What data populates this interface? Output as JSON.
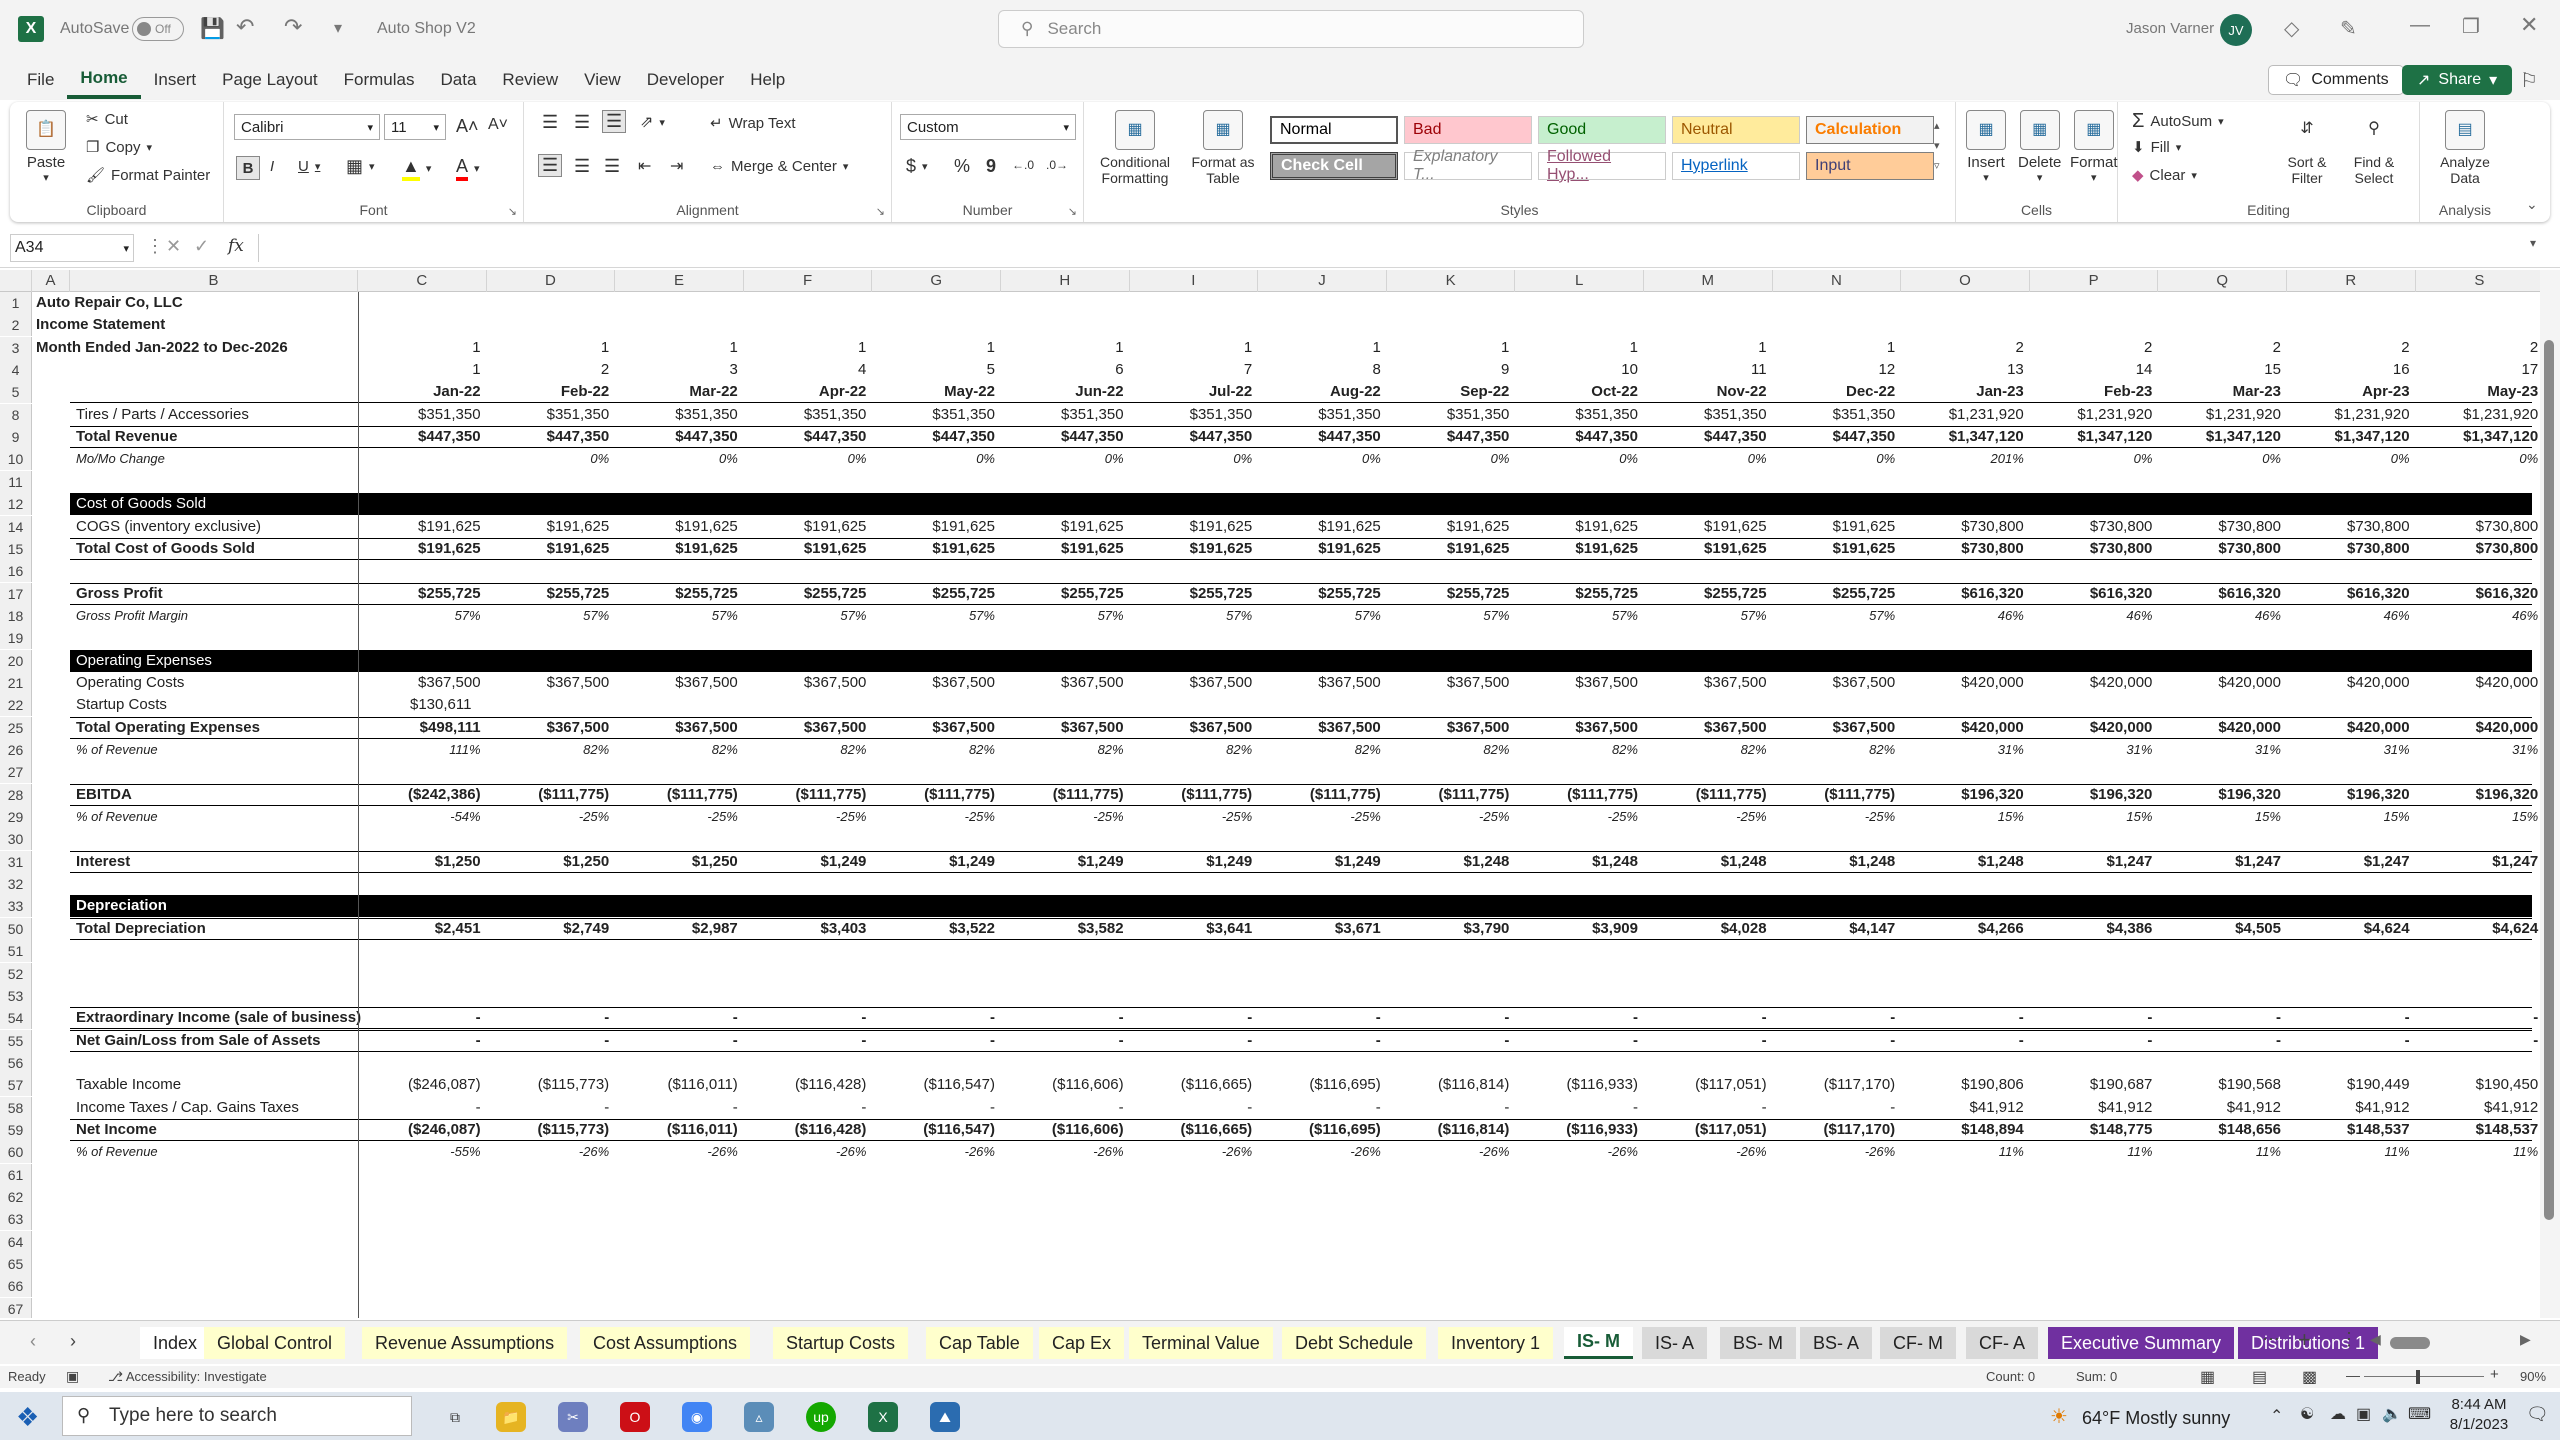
{
  "titlebar": {
    "autosave_label": "AutoSave",
    "autosave_state": "Off",
    "doc_title": "Auto Shop V2",
    "search_placeholder": "Search",
    "user_name": "Jason Varner",
    "user_initials": "JV"
  },
  "menu": {
    "items": [
      "File",
      "Home",
      "Insert",
      "Page Layout",
      "Formulas",
      "Data",
      "Review",
      "View",
      "Developer",
      "Help"
    ],
    "active": "Home",
    "comments_label": "Comments",
    "share_label": "Share"
  },
  "ribbon": {
    "clipboard": {
      "label": "Clipboard",
      "paste": "Paste",
      "cut": "Cut",
      "copy": "Copy",
      "format_painter": "Format Painter"
    },
    "font": {
      "label": "Font",
      "font_name": "Calibri",
      "font_size": "11",
      "bold": "B",
      "italic": "I",
      "underline": "U"
    },
    "alignment": {
      "label": "Alignment",
      "wrap_text": "Wrap Text",
      "merge_center": "Merge & Center"
    },
    "number": {
      "label": "Number",
      "format": "Custom",
      "currency": "$",
      "percent": "%",
      "comma": "9"
    },
    "styles": {
      "label": "Styles",
      "conditional_formatting": "Conditional Formatting",
      "format_as_table": "Format as Table",
      "cells": [
        {
          "name": "Normal",
          "bg": "#ffffff",
          "fg": "#000000"
        },
        {
          "name": "Bad",
          "bg": "#ffc7ce",
          "fg": "#9c0006"
        },
        {
          "name": "Good",
          "bg": "#c6efce",
          "fg": "#006100"
        },
        {
          "name": "Neutral",
          "bg": "#ffeb9c",
          "fg": "#9c5700"
        },
        {
          "name": "Calculation",
          "bg": "#f2f2f2",
          "fg": "#fa7d00"
        },
        {
          "name": "Check Cell",
          "bg": "#a5a5a5",
          "fg": "#ffffff"
        },
        {
          "name": "Explanatory T...",
          "bg": "#ffffff",
          "fg": "#7f7f7f"
        },
        {
          "name": "Followed Hyp...",
          "bg": "#ffffff",
          "fg": "#954f72"
        },
        {
          "name": "Hyperlink",
          "bg": "#ffffff",
          "fg": "#0563c1"
        },
        {
          "name": "Input",
          "bg": "#ffcc99",
          "fg": "#3f3f76"
        }
      ]
    },
    "cells": {
      "label": "Cells",
      "insert": "Insert",
      "delete": "Delete",
      "format": "Format"
    },
    "editing": {
      "label": "Editing",
      "autosum": "AutoSum",
      "fill": "Fill",
      "clear": "Clear",
      "sort_filter": "Sort & Filter",
      "find_select": "Find & Select"
    },
    "analysis": {
      "label": "Analysis",
      "analyze_data": "Analyze Data"
    }
  },
  "formula_bar": {
    "name_box": "A34",
    "fx": "fx",
    "formula": ""
  },
  "columns": [
    "A",
    "B",
    "C",
    "D",
    "E",
    "F",
    "G",
    "H",
    "I",
    "J",
    "K",
    "L",
    "M",
    "N",
    "O",
    "P",
    "Q",
    "R",
    "S"
  ],
  "sheet": {
    "rows": [
      {
        "n": "1",
        "label": "Auto Repair Co, LLC",
        "style": "title",
        "values": []
      },
      {
        "n": "2",
        "label": "Income Statement",
        "style": "title",
        "values": []
      },
      {
        "n": "3",
        "label": "Month Ended Jan-2022 to Dec-2026",
        "style": "title",
        "values": [
          "1",
          "1",
          "1",
          "1",
          "1",
          "1",
          "1",
          "1",
          "1",
          "1",
          "1",
          "1",
          "2",
          "2",
          "2",
          "2",
          "2"
        ]
      },
      {
        "n": "4",
        "label": "",
        "style": "plain",
        "values": [
          "1",
          "2",
          "3",
          "4",
          "5",
          "6",
          "7",
          "8",
          "9",
          "10",
          "11",
          "12",
          "13",
          "14",
          "15",
          "16",
          "17"
        ]
      },
      {
        "n": "5",
        "label": "",
        "style": "dates",
        "values": [
          "Jan-22",
          "Feb-22",
          "Mar-22",
          "Apr-22",
          "May-22",
          "Jun-22",
          "Jul-22",
          "Aug-22",
          "Sep-22",
          "Oct-22",
          "Nov-22",
          "Dec-22",
          "Jan-23",
          "Feb-23",
          "Mar-23",
          "Apr-23",
          "May-23"
        ]
      },
      {
        "n": "8",
        "label": "Tires / Parts / Accessories",
        "style": "plain",
        "values": [
          "$351,350",
          "$351,350",
          "$351,350",
          "$351,350",
          "$351,350",
          "$351,350",
          "$351,350",
          "$351,350",
          "$351,350",
          "$351,350",
          "$351,350",
          "$351,350",
          "$1,231,920",
          "$1,231,920",
          "$1,231,920",
          "$1,231,920",
          "$1,231,920"
        ]
      },
      {
        "n": "9",
        "label": "Total Revenue",
        "style": "total",
        "values": [
          "$447,350",
          "$447,350",
          "$447,350",
          "$447,350",
          "$447,350",
          "$447,350",
          "$447,350",
          "$447,350",
          "$447,350",
          "$447,350",
          "$447,350",
          "$447,350",
          "$1,347,120",
          "$1,347,120",
          "$1,347,120",
          "$1,347,120",
          "$1,347,120"
        ]
      },
      {
        "n": "10",
        "label": "Mo/Mo Change",
        "style": "ital",
        "values": [
          "",
          "0%",
          "0%",
          "0%",
          "0%",
          "0%",
          "0%",
          "0%",
          "0%",
          "0%",
          "0%",
          "0%",
          "201%",
          "0%",
          "0%",
          "0%",
          "0%"
        ]
      },
      {
        "n": "11",
        "label": "",
        "style": "plain",
        "values": []
      },
      {
        "n": "12",
        "label": "Cost of Goods Sold",
        "style": "hdr",
        "values": []
      },
      {
        "n": "14",
        "label": "COGS (inventory exclusive)",
        "style": "plain",
        "values": [
          "$191,625",
          "$191,625",
          "$191,625",
          "$191,625",
          "$191,625",
          "$191,625",
          "$191,625",
          "$191,625",
          "$191,625",
          "$191,625",
          "$191,625",
          "$191,625",
          "$730,800",
          "$730,800",
          "$730,800",
          "$730,800",
          "$730,800"
        ]
      },
      {
        "n": "15",
        "label": "Total Cost of Goods Sold",
        "style": "total",
        "values": [
          "$191,625",
          "$191,625",
          "$191,625",
          "$191,625",
          "$191,625",
          "$191,625",
          "$191,625",
          "$191,625",
          "$191,625",
          "$191,625",
          "$191,625",
          "$191,625",
          "$730,800",
          "$730,800",
          "$730,800",
          "$730,800",
          "$730,800"
        ]
      },
      {
        "n": "16",
        "label": "",
        "style": "plain",
        "values": []
      },
      {
        "n": "17",
        "label": "Gross Profit",
        "style": "total",
        "values": [
          "$255,725",
          "$255,725",
          "$255,725",
          "$255,725",
          "$255,725",
          "$255,725",
          "$255,725",
          "$255,725",
          "$255,725",
          "$255,725",
          "$255,725",
          "$255,725",
          "$616,320",
          "$616,320",
          "$616,320",
          "$616,320",
          "$616,320"
        ]
      },
      {
        "n": "18",
        "label": "Gross Profit Margin",
        "style": "ital",
        "values": [
          "57%",
          "57%",
          "57%",
          "57%",
          "57%",
          "57%",
          "57%",
          "57%",
          "57%",
          "57%",
          "57%",
          "57%",
          "46%",
          "46%",
          "46%",
          "46%",
          "46%"
        ]
      },
      {
        "n": "19",
        "label": "",
        "style": "plain",
        "values": []
      },
      {
        "n": "20",
        "label": "Operating Expenses",
        "style": "hdr",
        "values": []
      },
      {
        "n": "21",
        "label": "Operating Costs",
        "style": "plain",
        "values": [
          "$367,500",
          "$367,500",
          "$367,500",
          "$367,500",
          "$367,500",
          "$367,500",
          "$367,500",
          "$367,500",
          "$367,500",
          "$367,500",
          "$367,500",
          "$367,500",
          "$420,000",
          "$420,000",
          "$420,000",
          "$420,000",
          "$420,000"
        ]
      },
      {
        "n": "22",
        "label": "Startup Costs",
        "style": "plainleft",
        "values": [
          "$130,611"
        ]
      },
      {
        "n": "25",
        "label": "Total Operating Expenses",
        "style": "total",
        "values": [
          "$498,111",
          "$367,500",
          "$367,500",
          "$367,500",
          "$367,500",
          "$367,500",
          "$367,500",
          "$367,500",
          "$367,500",
          "$367,500",
          "$367,500",
          "$367,500",
          "$420,000",
          "$420,000",
          "$420,000",
          "$420,000",
          "$420,000"
        ]
      },
      {
        "n": "26",
        "label": "% of Revenue",
        "style": "ital",
        "values": [
          "111%",
          "82%",
          "82%",
          "82%",
          "82%",
          "82%",
          "82%",
          "82%",
          "82%",
          "82%",
          "82%",
          "82%",
          "31%",
          "31%",
          "31%",
          "31%",
          "31%"
        ]
      },
      {
        "n": "27",
        "label": "",
        "style": "plain",
        "values": []
      },
      {
        "n": "28",
        "label": "EBITDA",
        "style": "total",
        "values": [
          "($242,386)",
          "($111,775)",
          "($111,775)",
          "($111,775)",
          "($111,775)",
          "($111,775)",
          "($111,775)",
          "($111,775)",
          "($111,775)",
          "($111,775)",
          "($111,775)",
          "($111,775)",
          "$196,320",
          "$196,320",
          "$196,320",
          "$196,320",
          "$196,320"
        ]
      },
      {
        "n": "29",
        "label": "% of Revenue",
        "style": "ital",
        "values": [
          "-54%",
          "-25%",
          "-25%",
          "-25%",
          "-25%",
          "-25%",
          "-25%",
          "-25%",
          "-25%",
          "-25%",
          "-25%",
          "-25%",
          "15%",
          "15%",
          "15%",
          "15%",
          "15%"
        ]
      },
      {
        "n": "30",
        "label": "",
        "style": "plain",
        "values": []
      },
      {
        "n": "31",
        "label": "Interest",
        "style": "total",
        "values": [
          "$1,250",
          "$1,250",
          "$1,250",
          "$1,249",
          "$1,249",
          "$1,249",
          "$1,249",
          "$1,249",
          "$1,248",
          "$1,248",
          "$1,248",
          "$1,248",
          "$1,248",
          "$1,247",
          "$1,247",
          "$1,247",
          "$1,247"
        ]
      },
      {
        "n": "32",
        "label": "",
        "style": "plain",
        "values": []
      },
      {
        "n": "33",
        "label": "Depreciation",
        "style": "hdrbold",
        "values": []
      },
      {
        "n": "50",
        "label": "Total Depreciation",
        "style": "total",
        "values": [
          "$2,451",
          "$2,749",
          "$2,987",
          "$3,403",
          "$3,522",
          "$3,582",
          "$3,641",
          "$3,671",
          "$3,790",
          "$3,909",
          "$4,028",
          "$4,147",
          "$4,266",
          "$4,386",
          "$4,505",
          "$4,624",
          "$4,624"
        ]
      },
      {
        "n": "51",
        "label": "",
        "style": "plain",
        "values": []
      },
      {
        "n": "52",
        "label": "",
        "style": "plain",
        "values": []
      },
      {
        "n": "53",
        "label": "",
        "style": "plain",
        "values": []
      },
      {
        "n": "54",
        "label": "Extraordinary Income (sale of business)",
        "style": "total",
        "values": [
          "-",
          "-",
          "-",
          "-",
          "-",
          "-",
          "-",
          "-",
          "-",
          "-",
          "-",
          "-",
          "-",
          "-",
          "-",
          "-",
          "-"
        ]
      },
      {
        "n": "55",
        "label": "Net Gain/Loss from Sale of Assets",
        "style": "total",
        "values": [
          "-",
          "-",
          "-",
          "-",
          "-",
          "-",
          "-",
          "-",
          "-",
          "-",
          "-",
          "-",
          "-",
          "-",
          "-",
          "-",
          "-"
        ]
      },
      {
        "n": "56",
        "label": "",
        "style": "plain",
        "values": []
      },
      {
        "n": "57",
        "label": "Taxable Income",
        "style": "plain",
        "values": [
          "($246,087)",
          "($115,773)",
          "($116,011)",
          "($116,428)",
          "($116,547)",
          "($116,606)",
          "($116,665)",
          "($116,695)",
          "($116,814)",
          "($116,933)",
          "($117,051)",
          "($117,170)",
          "$190,806",
          "$190,687",
          "$190,568",
          "$190,449",
          "$190,450"
        ]
      },
      {
        "n": "58",
        "label": "Income Taxes / Cap. Gains Taxes",
        "style": "plain",
        "values": [
          "-",
          "-",
          "-",
          "-",
          "-",
          "-",
          "-",
          "-",
          "-",
          "-",
          "-",
          "-",
          "$41,912",
          "$41,912",
          "$41,912",
          "$41,912",
          "$41,912"
        ]
      },
      {
        "n": "59",
        "label": "Net Income",
        "style": "total",
        "values": [
          "($246,087)",
          "($115,773)",
          "($116,011)",
          "($116,428)",
          "($116,547)",
          "($116,606)",
          "($116,665)",
          "($116,695)",
          "($116,814)",
          "($116,933)",
          "($117,051)",
          "($117,170)",
          "$148,894",
          "$148,775",
          "$148,656",
          "$148,537",
          "$148,537"
        ]
      },
      {
        "n": "60",
        "label": "% of Revenue",
        "style": "ital",
        "values": [
          "-55%",
          "-26%",
          "-26%",
          "-26%",
          "-26%",
          "-26%",
          "-26%",
          "-26%",
          "-26%",
          "-26%",
          "-26%",
          "-26%",
          "11%",
          "11%",
          "11%",
          "11%",
          "11%"
        ]
      },
      {
        "n": "61",
        "label": "",
        "style": "plain",
        "values": []
      },
      {
        "n": "62",
        "label": "",
        "style": "plain",
        "values": []
      },
      {
        "n": "63",
        "label": "",
        "style": "plain",
        "values": []
      },
      {
        "n": "64",
        "label": "",
        "style": "plain",
        "values": []
      },
      {
        "n": "65",
        "label": "",
        "style": "plain",
        "values": []
      },
      {
        "n": "66",
        "label": "",
        "style": "plain",
        "values": []
      },
      {
        "n": "67",
        "label": "",
        "style": "plain",
        "values": []
      }
    ]
  },
  "tabs": [
    {
      "name": "Index",
      "bg": "#ffffff",
      "fg": "#222222"
    },
    {
      "name": "Global Control",
      "bg": "#ffffcc",
      "fg": "#222222"
    },
    {
      "name": "Revenue Assumptions",
      "bg": "#ffffcc",
      "fg": "#222222"
    },
    {
      "name": "Cost Assumptions",
      "bg": "#ffffcc",
      "fg": "#222222"
    },
    {
      "name": "Startup Costs",
      "bg": "#ffffcc",
      "fg": "#222222"
    },
    {
      "name": "Cap Table",
      "bg": "#ffffcc",
      "fg": "#222222"
    },
    {
      "name": "Cap Ex",
      "bg": "#ffffcc",
      "fg": "#222222"
    },
    {
      "name": "Terminal Value",
      "bg": "#ffffcc",
      "fg": "#222222"
    },
    {
      "name": "Debt Schedule",
      "bg": "#ffffcc",
      "fg": "#222222"
    },
    {
      "name": "Inventory 1",
      "bg": "#ffffcc",
      "fg": "#222222"
    },
    {
      "name": "IS- M",
      "bg": "#ffffff",
      "fg": "#185c37"
    },
    {
      "name": "IS- A",
      "bg": "#d9d9d9",
      "fg": "#222222"
    },
    {
      "name": "BS- M",
      "bg": "#d9d9d9",
      "fg": "#222222"
    },
    {
      "name": "BS- A",
      "bg": "#d9d9d9",
      "fg": "#222222"
    },
    {
      "name": "CF- M",
      "bg": "#d9d9d9",
      "fg": "#222222"
    },
    {
      "name": "CF- A",
      "bg": "#d9d9d9",
      "fg": "#222222"
    },
    {
      "name": "Executive Summary",
      "bg": "#7030a0",
      "fg": "#ffffff"
    },
    {
      "name": "Distributions 1",
      "bg": "#7030a0",
      "fg": "#ffffff"
    }
  ],
  "status": {
    "ready": "Ready",
    "accessibility": "Accessibility: Investigate",
    "count": "Count: 0",
    "sum": "Sum: 0",
    "zoom": "90%"
  },
  "taskbar": {
    "search_placeholder": "Type here to search",
    "weather": "64°F  Mostly sunny",
    "time": "8:44 AM",
    "date": "8/1/2023"
  }
}
